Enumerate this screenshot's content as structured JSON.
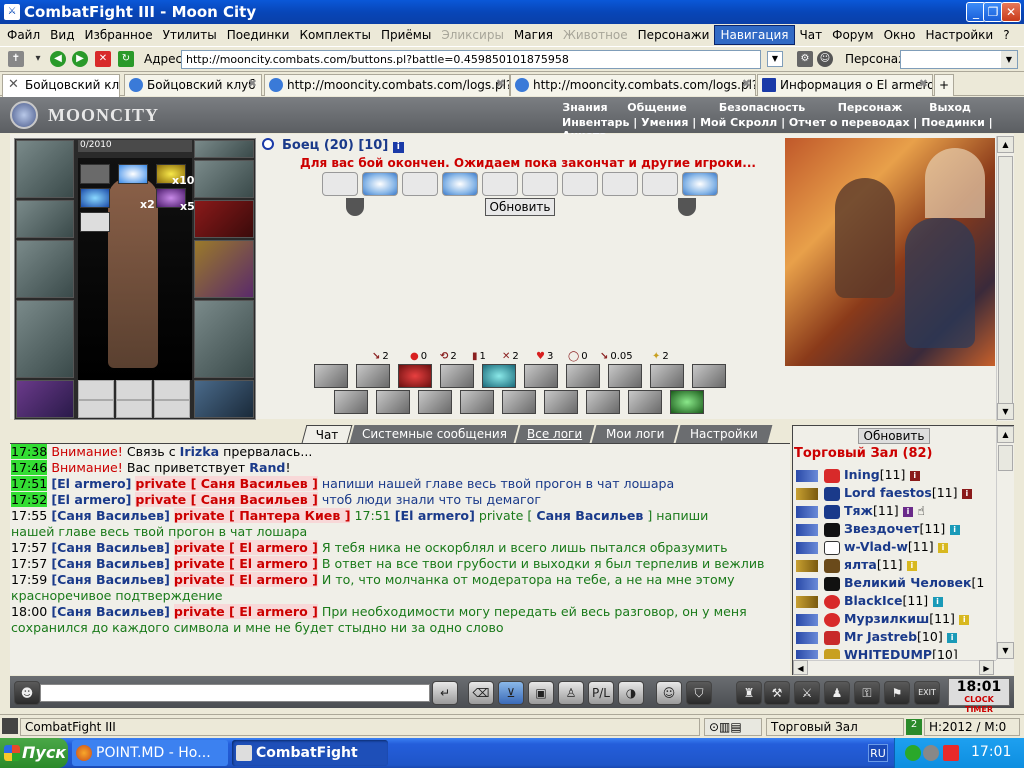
{
  "window": {
    "title": "CombatFight III - Moon City"
  },
  "menu": [
    "Файл",
    "Вид",
    "Избранное",
    "Утилиты",
    "Поединки",
    "Комплекты",
    "Приёмы",
    "Эликсиры",
    "Магия",
    "Животное",
    "Персонажи",
    "Навигация",
    "Чат",
    "Форум",
    "Окно",
    "Настройки",
    "?"
  ],
  "address": {
    "label": "Адрес:",
    "url": "http://mooncity.combats.com/buttons.pl?battle=0.459850101875958",
    "char_label": "Персонаж:"
  },
  "tabs": [
    {
      "label": "Бойцовский клуб"
    },
    {
      "label": "Бойцовский клуб"
    },
    {
      "label": "http://mooncity.combats.com/logs.pl?l..."
    },
    {
      "label": "http://mooncity.combats.com/logs.pl?l..."
    },
    {
      "label": "Информация о El armero"
    }
  ],
  "game": {
    "logo": "MOONCITY",
    "nav": [
      "Знания",
      "Общение",
      "Безопасность",
      "Персонаж",
      "Выход"
    ],
    "subnav": "Инвентарь | Умения | Мой Скролл | Отчет о переводах | Поединки | Анкета",
    "hp": "0/2010",
    "inv_counts": [
      "x10",
      "x2",
      "x5"
    ],
    "fighter": "Боец (20) [10]",
    "battle_msg": "Для вас бой окончен. Ожидаем пока закончат и другие игроки...",
    "refresh": "Обновить",
    "stats": [
      "2",
      "0",
      "2",
      "1",
      "2",
      "3",
      "0",
      "0.05",
      "2"
    ]
  },
  "chat_tabs": [
    "Чат",
    "Системные сообщения",
    "Все логи",
    "Мои логи",
    "Настройки"
  ],
  "chat": [
    {
      "time": "17:38",
      "t1": "Внимание!",
      "t2": " Связь с ",
      "nick": "Irizka",
      "t3": " прервалась..."
    },
    {
      "time": "17:46",
      "t1": "Внимание!",
      "t2": " Вас приветствует ",
      "nick": "Rand",
      "t3": "!"
    },
    {
      "time": "17:51",
      "nick": "El armero",
      "priv": "private",
      "to": "Саня Васильев",
      "text": "напиши нашей главе весь твой прогон в чат лошара"
    },
    {
      "time": "17:52",
      "nick": "El armero",
      "priv": "private",
      "to": "Саня Васильев",
      "text": "чтоб люди знали что ты демагог"
    },
    {
      "time": "17:55",
      "nick": "Саня Васильев",
      "priv": "private",
      "to": "Пантера Киев",
      "text1": "17:51",
      "nick2": "El armero",
      "text2": "private [",
      "to2": "Саня Васильев",
      "text3": "] напиши",
      "text4": "нашей главе весь твой прогон в чат лошара"
    },
    {
      "time": "17:57",
      "nick": "Саня Васильев",
      "priv": "private",
      "to": "El armero",
      "text": "Я тебя ника не оскорблял и всего лишь пытался образумить"
    },
    {
      "time": "17:57",
      "nick": "Саня Васильев",
      "priv": "private",
      "to": "El armero",
      "text": "В ответ на все твои грубости и выходки я был терпелив и вежлив"
    },
    {
      "time": "17:59",
      "nick": "Саня Васильев",
      "priv": "private",
      "to": "El armero",
      "text": "И то, что молчанка от модератора на тебе, а не на мне этому красноречивое подтверждение"
    },
    {
      "time": "18:00",
      "nick": "Саня Васильев",
      "priv": "private",
      "to": "El armero",
      "text": "При необходимости могу передать ей весь разговор, он у меня сохранился до каждого символа и мне не будет стыдно ни за одно слово"
    }
  ],
  "room": {
    "refresh": "Обновить",
    "title": "Торговый Зал (82)",
    "users": [
      {
        "name": "Ining",
        "lvl": "[11]"
      },
      {
        "name": "Lord faestos",
        "lvl": "[11]"
      },
      {
        "name": "Тяж",
        "lvl": "[11]"
      },
      {
        "name": "Звездочет",
        "lvl": "[11]"
      },
      {
        "name": "w-Vlad-w",
        "lvl": "[11]"
      },
      {
        "name": "ялта",
        "lvl": "[11]"
      },
      {
        "name": "Великий Человек",
        "lvl": "[1"
      },
      {
        "name": "BlackIce",
        "lvl": "[11]"
      },
      {
        "name": "Мурзилкиш",
        "lvl": "[11]"
      },
      {
        "name": "Mr Jastreb",
        "lvl": "[10]"
      },
      {
        "name": "WHITEDUMP",
        "lvl": "[10]"
      }
    ]
  },
  "clock": {
    "time": "18:01",
    "label": "CLOCK TIMER"
  },
  "status": {
    "app": "CombatFight III",
    "room": "Торговый Зал",
    "info": "H:2012 / M:0"
  },
  "taskbar": {
    "start": "Пуск",
    "task1": "POINT.MD - Но...",
    "task2": "CombatFight",
    "lang": "RU",
    "time": "17:01"
  }
}
